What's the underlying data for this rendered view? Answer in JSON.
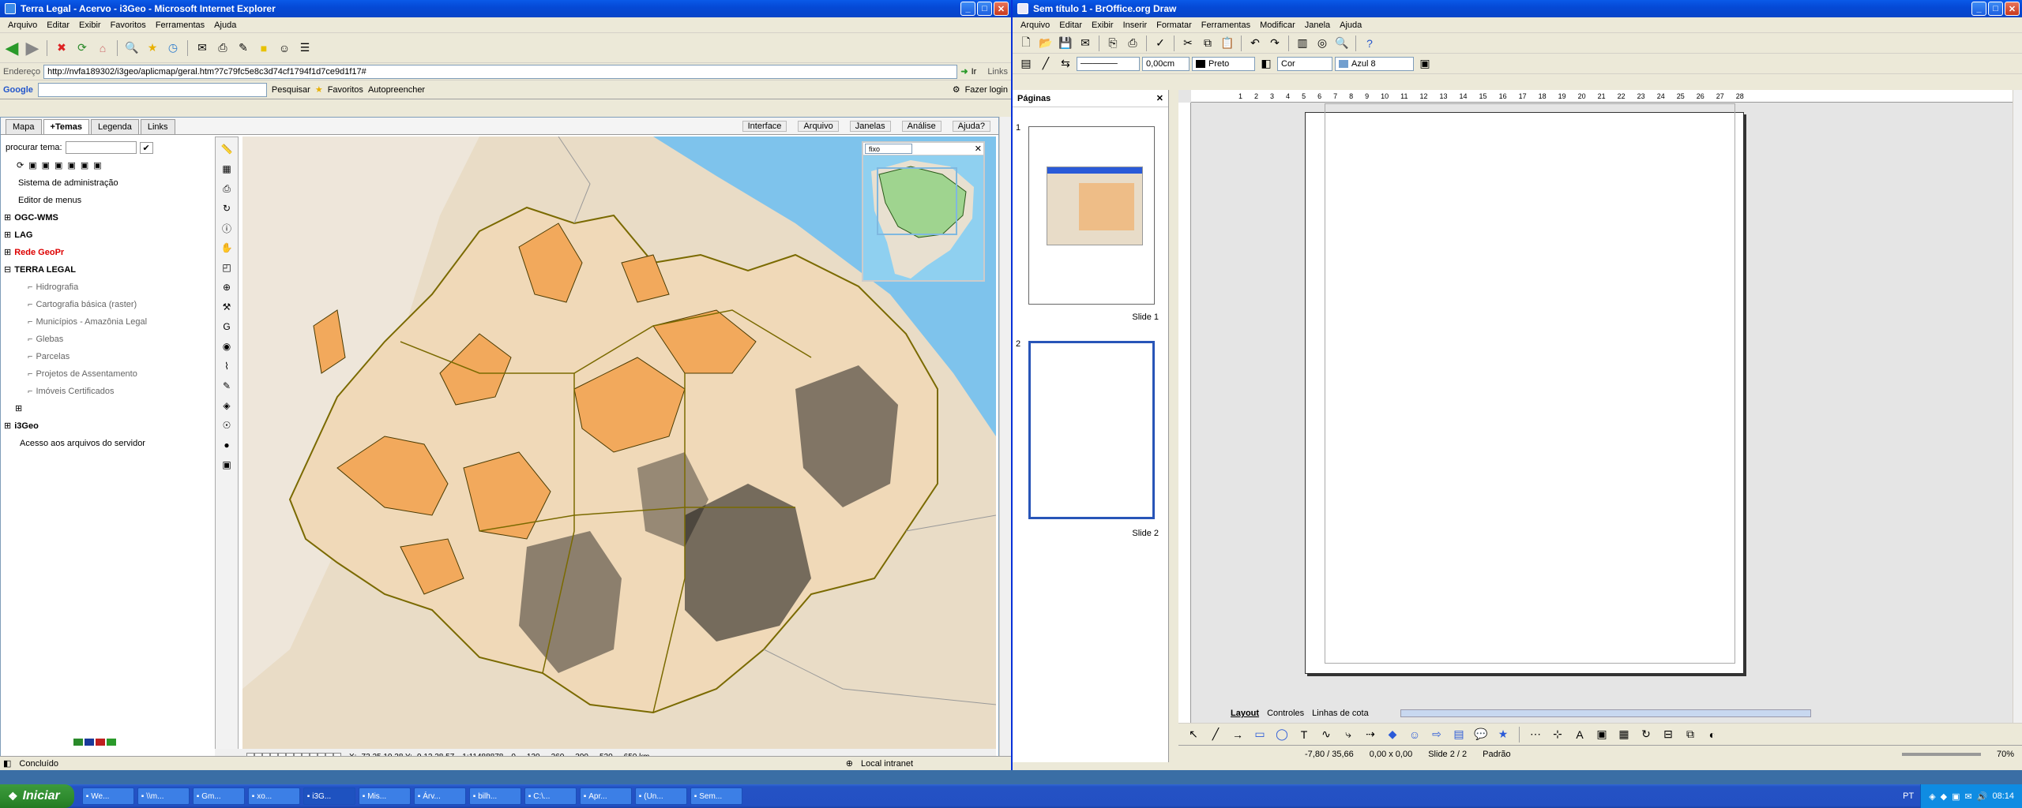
{
  "ie": {
    "title": "Terra Legal - Acervo - i3Geo - Microsoft Internet Explorer",
    "menu": [
      "Arquivo",
      "Editar",
      "Exibir",
      "Favoritos",
      "Ferramentas",
      "Ajuda"
    ],
    "address_label": "Endereço",
    "address": "http://nvfa189302/i3geo/aplicmap/geral.htm?7c79fc5e8c3d74cf1794f1d7ce9d1f17#",
    "go_label": "Ir",
    "links_label": "Links",
    "google": {
      "logo": "Google",
      "search": "Pesquisar",
      "favorites": "Favoritos",
      "autofill": "Autopreencher",
      "login": "Fazer login"
    },
    "status": "Concluído",
    "zone": "Local intranet"
  },
  "i3geo": {
    "tabs": [
      "Mapa",
      "+Temas",
      "Legenda",
      "Links"
    ],
    "right_tabs": [
      "Interface",
      "Arquivo",
      "Janelas",
      "Análise",
      "Ajuda?"
    ],
    "search_label": "procurar tema:",
    "tree": {
      "admin": "Sistema de administração",
      "menus": "Editor de menus",
      "ogc": "OGC-WMS",
      "lag": "LAG",
      "geopr": "Rede GeoPr",
      "terra": "TERRA LEGAL",
      "sub": [
        "Hidrografia",
        "Cartografia básica (raster)",
        "Municípios - Amazônia Legal",
        "Glebas",
        "Parcelas",
        "Projetos de Assentamento",
        "Imóveis Certificados"
      ],
      "i3geo": "i3Geo",
      "server": "Acesso aos arquivos do servidor"
    },
    "overview_select": "fixo",
    "scalebar": [
      "0",
      "130",
      "260",
      "390",
      "520",
      "650 km"
    ],
    "coords": "X: -73 25 10.28  Y: -9 12 28.57",
    "scale": "1:11488878"
  },
  "draw": {
    "title": "Sem título 1 - BrOffice.org Draw",
    "menu": [
      "Arquivo",
      "Editar",
      "Exibir",
      "Inserir",
      "Formatar",
      "Ferramentas",
      "Modificar",
      "Janela",
      "Ajuda"
    ],
    "line_width": "0,00cm",
    "line_color": "Preto",
    "fill_type": "Cor",
    "fill_color": "Azul 8",
    "pages_title": "Páginas",
    "slides": [
      {
        "num": "1",
        "label": "Slide 1"
      },
      {
        "num": "2",
        "label": "Slide 2"
      }
    ],
    "layer_tabs": [
      "Layout",
      "Controles",
      "Linhas de cota"
    ],
    "ruler": [
      "1",
      "2",
      "3",
      "4",
      "5",
      "6",
      "7",
      "8",
      "9",
      "10",
      "11",
      "12",
      "13",
      "14",
      "15",
      "16",
      "17",
      "18",
      "19",
      "20",
      "21",
      "22",
      "23",
      "24",
      "25",
      "26",
      "27",
      "28"
    ],
    "status": {
      "pos": "-7,80 / 35,66",
      "size": "0,00 x 0,00",
      "slide": "Slide 2 / 2",
      "style": "Padrão",
      "zoom": "70%"
    }
  },
  "taskbar": {
    "start": "Iniciar",
    "tasks": [
      "We...",
      "\\\\m...",
      "Gm...",
      "xo...",
      "i3G...",
      "Mis...",
      "Árv...",
      "bilh...",
      "C:\\...",
      "Apr...",
      "(Un...",
      "Sem..."
    ],
    "lang": "PT",
    "clock": "08:14"
  }
}
